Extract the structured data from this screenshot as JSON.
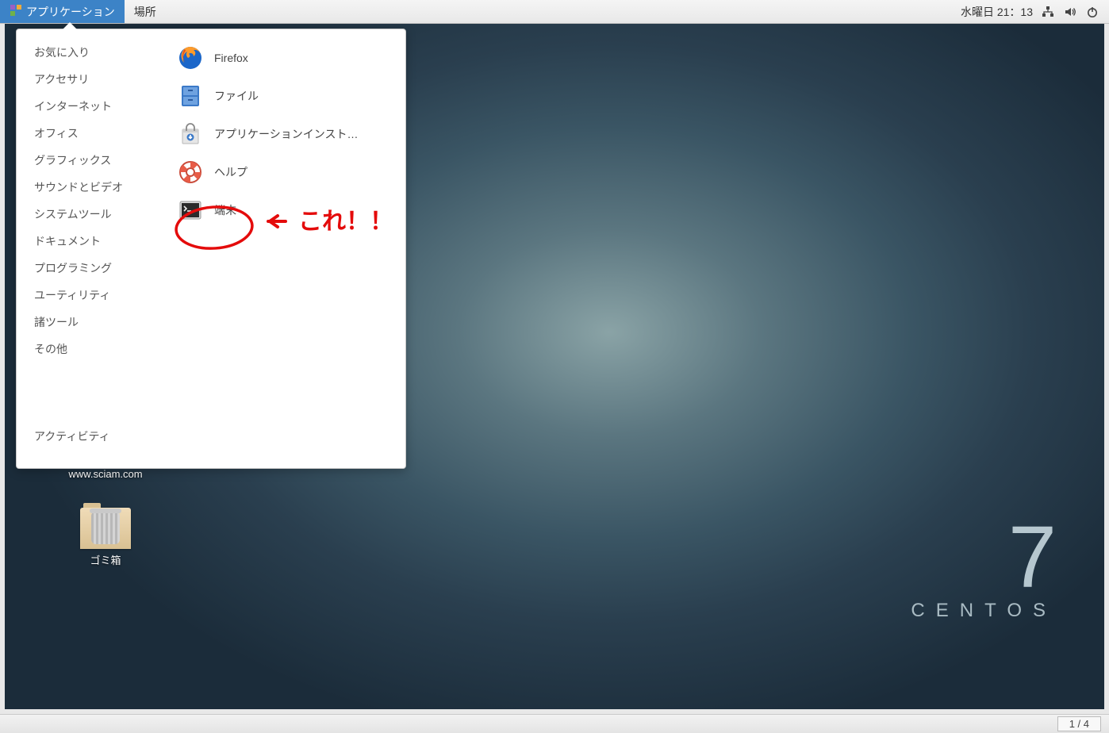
{
  "topbar": {
    "applications_label": "アプリケーション",
    "places_label": "場所",
    "datetime": "水曜日 21：13"
  },
  "menu": {
    "categories": [
      "お気に入り",
      "アクセサリ",
      "インターネット",
      "オフィス",
      "グラフィックス",
      "サウンドとビデオ",
      "システムツール",
      "ドキュメント",
      "プログラミング",
      "ユーティリティ",
      "諸ツール",
      "その他"
    ],
    "activity_label": "アクティビティ",
    "apps": [
      {
        "label": "Firefox",
        "icon": "firefox"
      },
      {
        "label": "ファイル",
        "icon": "files"
      },
      {
        "label": "アプリケーションインスト…",
        "icon": "software"
      },
      {
        "label": "ヘルプ",
        "icon": "help"
      },
      {
        "label": "端末",
        "icon": "terminal"
      }
    ]
  },
  "annotation": {
    "text": "←これ！！"
  },
  "desktop": {
    "link_label": "www.sciam.com",
    "trash_label": "ゴミ箱"
  },
  "branding": {
    "version": "7",
    "name": "CENTOS"
  },
  "bottombar": {
    "workspace": "1 / 4"
  }
}
